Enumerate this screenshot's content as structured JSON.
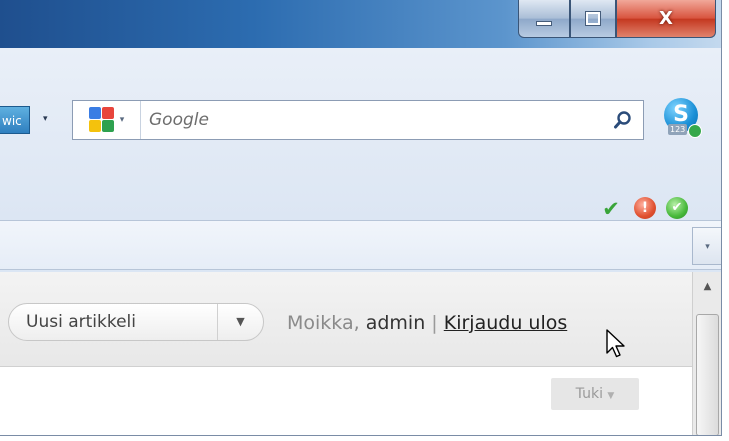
{
  "titlebar": {
    "minimize_label": "—",
    "maximize_label": "☐",
    "close_label": "X"
  },
  "toolbar": {
    "addon_label": "wic",
    "addon_dropdown": "▾",
    "search": {
      "engine_icon": "google-logo-icon",
      "engine_dropdown": "▾",
      "placeholder": "Google",
      "value": ""
    },
    "skype_badge": "123"
  },
  "status": {
    "check": "✔",
    "error": "!",
    "ok": "✔"
  },
  "cmdbar": {
    "chevron": "▾"
  },
  "admin_bar": {
    "new_article_label": "Uusi artikkeli",
    "new_article_toggle": "▼",
    "greeting": "Moikka,",
    "username": "admin",
    "separator": "|",
    "logout_label": "Kirjaudu ulos"
  },
  "help": {
    "label": "Tuki",
    "arrow": "▼"
  },
  "scrollbar": {
    "up_arrow": "▲"
  }
}
